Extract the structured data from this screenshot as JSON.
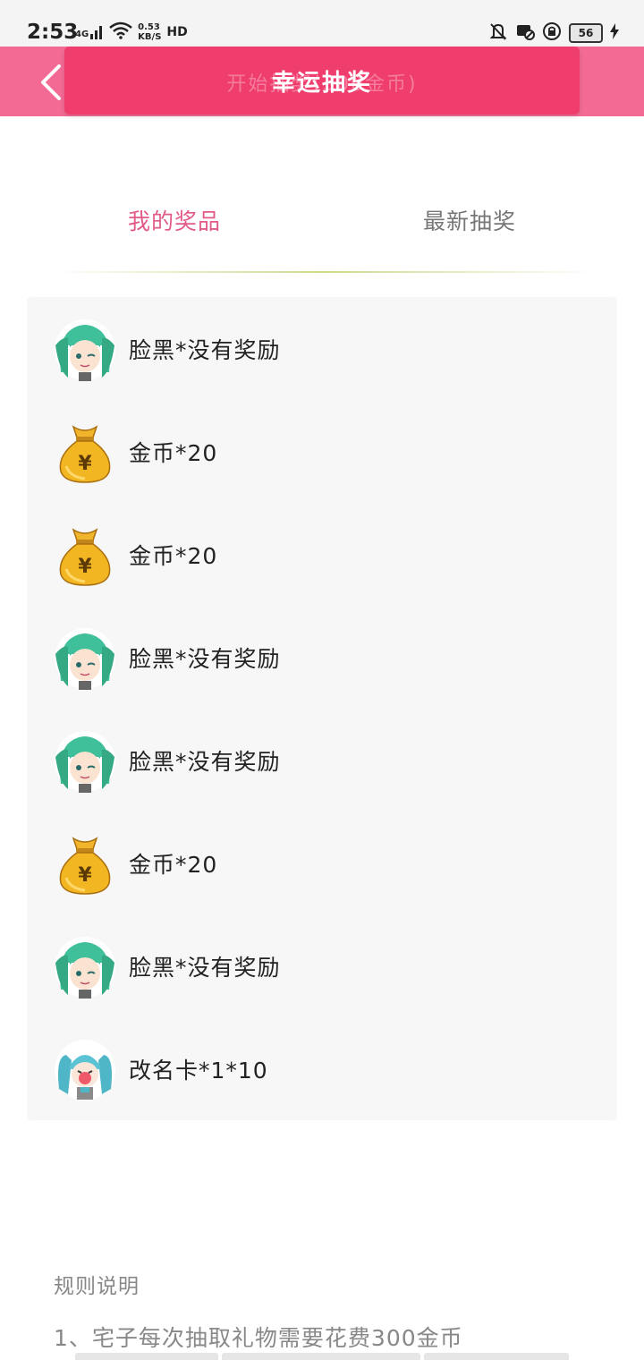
{
  "status_bar": {
    "time": "2:53",
    "network": "4G",
    "speed_value": "0.53",
    "speed_unit": "KB/S",
    "hd": "HD",
    "battery": "56"
  },
  "header": {
    "back_icon": "chevron-left-icon",
    "banner_ghost": "开始抽奖(300金币)",
    "banner_title": "幸运抽奖"
  },
  "tabs": [
    {
      "label": "我的奖品",
      "active": true
    },
    {
      "label": "最新抽奖",
      "active": false
    }
  ],
  "prizes": [
    {
      "icon": "avatar-miku-icon",
      "label": "脸黑*没有奖励"
    },
    {
      "icon": "money-bag-icon",
      "label": "金币*20"
    },
    {
      "icon": "money-bag-icon",
      "label": "金币*20"
    },
    {
      "icon": "avatar-miku-icon",
      "label": "脸黑*没有奖励"
    },
    {
      "icon": "avatar-miku-icon",
      "label": "脸黑*没有奖励"
    },
    {
      "icon": "money-bag-icon",
      "label": "金币*20"
    },
    {
      "icon": "avatar-miku-icon",
      "label": "脸黑*没有奖励"
    },
    {
      "icon": "avatar-miku-chibi-icon",
      "label": "改名卡*1*10"
    }
  ],
  "rules": {
    "title": "规则说明",
    "lines": [
      "1、宅子每次抽取礼物需要花费300金币"
    ]
  },
  "colors": {
    "header": "#f36b95",
    "banner": "#ef3d6e",
    "tab_active": "#e25a86",
    "panel_bg": "#f7f7f7"
  }
}
